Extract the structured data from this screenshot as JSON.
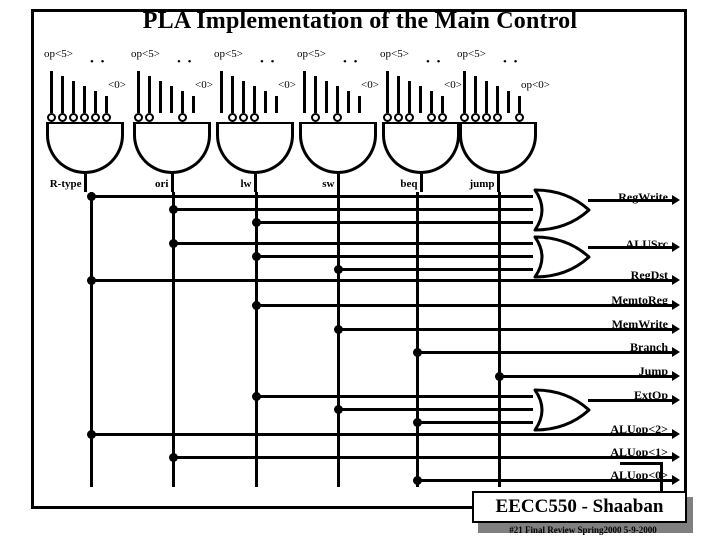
{
  "title": "PLA Implementation of the Main Control",
  "input_groups": [
    {
      "top_label": "op<5>",
      "bottom_label": "<0>",
      "ellipsis": "• •"
    },
    {
      "top_label": "op<5>",
      "bottom_label": "<0>",
      "ellipsis": "• •"
    },
    {
      "top_label": "op<5>",
      "bottom_label": "<0>",
      "ellipsis": "• •"
    },
    {
      "top_label": "op<5>",
      "bottom_label": "<0>",
      "ellipsis": "• •"
    },
    {
      "top_label": "op<5>",
      "bottom_label": "<0>",
      "ellipsis": "• •"
    },
    {
      "top_label": "op<5>",
      "bottom_label": "op<0>",
      "ellipsis": "• •"
    }
  ],
  "and_gates": [
    {
      "name": "R-type",
      "inverted_inputs": [
        true,
        true,
        true,
        true,
        true,
        true
      ]
    },
    {
      "name": "ori",
      "inverted_inputs": [
        true,
        true,
        false,
        false,
        true,
        false
      ]
    },
    {
      "name": "lw",
      "inverted_inputs": [
        false,
        true,
        true,
        true,
        false,
        false
      ]
    },
    {
      "name": "sw",
      "inverted_inputs": [
        false,
        true,
        false,
        true,
        false,
        false
      ]
    },
    {
      "name": "beq",
      "inverted_inputs": [
        true,
        true,
        true,
        false,
        true,
        true
      ]
    },
    {
      "name": "jump",
      "inverted_inputs": [
        true,
        true,
        true,
        true,
        false,
        true
      ]
    }
  ],
  "outputs": [
    {
      "label": "RegWrite",
      "gate": "or",
      "sources": [
        "R-type",
        "ori",
        "lw"
      ]
    },
    {
      "label": "ALUSrc",
      "gate": "or",
      "sources": [
        "ori",
        "lw",
        "sw"
      ]
    },
    {
      "label": "RegDst",
      "gate": "wire",
      "sources": [
        "R-type"
      ]
    },
    {
      "label": "MemtoReg",
      "gate": "wire",
      "sources": [
        "lw"
      ]
    },
    {
      "label": "MemWrite",
      "gate": "wire",
      "sources": [
        "sw"
      ]
    },
    {
      "label": "Branch",
      "gate": "wire",
      "sources": [
        "beq"
      ]
    },
    {
      "label": "Jump",
      "gate": "wire",
      "sources": [
        "jump"
      ]
    },
    {
      "label": "ExtOp",
      "gate": "or",
      "sources": [
        "lw",
        "sw",
        "beq"
      ]
    },
    {
      "label": "ALUop<2>",
      "gate": "wire",
      "sources": [
        "R-type"
      ]
    },
    {
      "label": "ALUop<1>",
      "gate": "wire",
      "sources": [
        "ori"
      ]
    },
    {
      "label": "ALUop<0>",
      "gate": "wire",
      "sources": [
        "beq"
      ]
    }
  ],
  "footer": {
    "badge": "EECC550 - Shaaban",
    "subtitle": "#21   Final Review   Spring2000    5-9-2000"
  },
  "colors": {
    "ink": "#000000",
    "background": "#ffffff",
    "shadow": "#808080"
  }
}
